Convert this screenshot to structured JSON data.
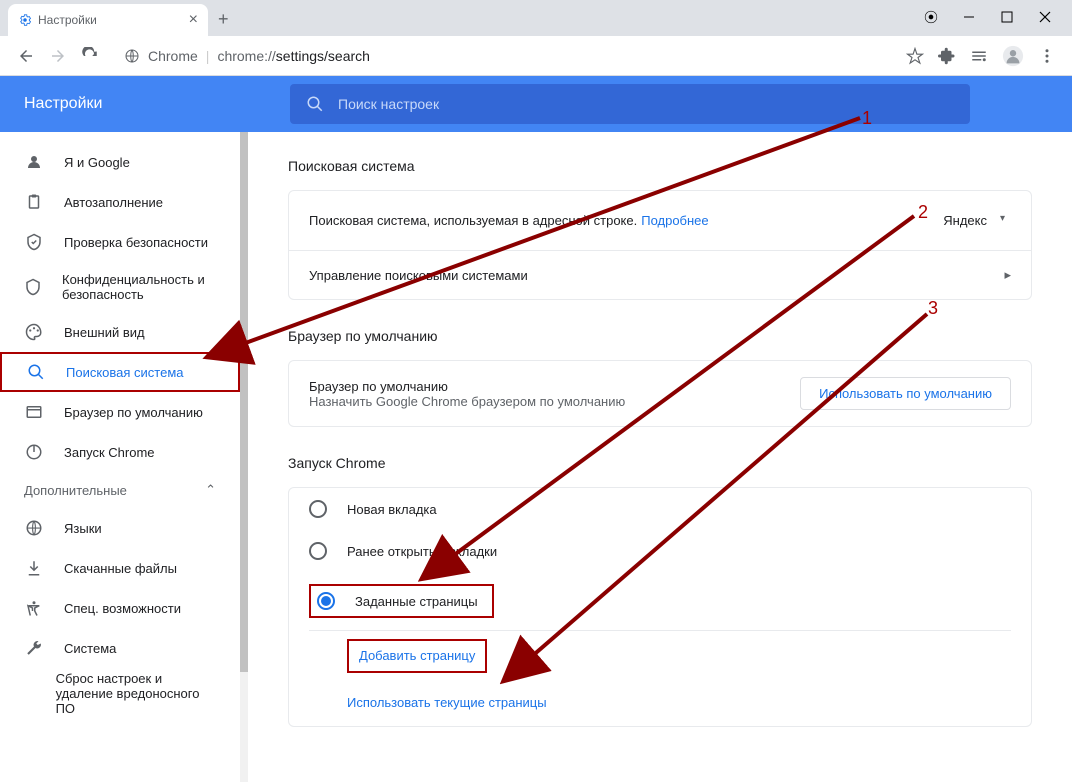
{
  "tab": {
    "title": "Настройки"
  },
  "url": {
    "host": "Chrome",
    "path": "chrome://settings/search",
    "path_protocol": "chrome://",
    "path_main": "settings/search"
  },
  "header": {
    "title": "Настройки"
  },
  "search": {
    "placeholder": "Поиск настроек"
  },
  "sidebar": {
    "items": [
      {
        "label": "Я и Google"
      },
      {
        "label": "Автозаполнение"
      },
      {
        "label": "Проверка безопасности"
      },
      {
        "label": "Конфиденциальность и безопасность"
      },
      {
        "label": "Внешний вид"
      },
      {
        "label": "Поисковая система"
      },
      {
        "label": "Браузер по умолчанию"
      },
      {
        "label": "Запуск Chrome"
      }
    ],
    "advanced_label": "Дополнительные",
    "advanced_items": [
      {
        "label": "Языки"
      },
      {
        "label": "Скачанные файлы"
      },
      {
        "label": "Спец. возможности"
      },
      {
        "label": "Система"
      },
      {
        "label": "Сброс настроек и удаление вредоносного ПО"
      }
    ]
  },
  "main": {
    "search_engine": {
      "title": "Поисковая система",
      "row1_text": "Поисковая система, используемая в адресной строке.",
      "row1_link": "Подробнее",
      "dropdown_value": "Яндекс",
      "row2_text": "Управление поисковыми системами"
    },
    "default_browser": {
      "title": "Браузер по умолчанию",
      "row_title": "Браузер по умолчанию",
      "row_subtitle": "Назначить Google Chrome браузером по умолчанию",
      "button": "Использовать по умолчанию"
    },
    "startup": {
      "title": "Запуск Chrome",
      "options": [
        {
          "label": "Новая вкладка"
        },
        {
          "label": "Ранее открытые вкладки"
        },
        {
          "label": "Заданные страницы"
        }
      ],
      "add_page": "Добавить страницу",
      "use_current": "Использовать текущие страницы"
    }
  },
  "annotations": {
    "n1": "1",
    "n2": "2",
    "n3": "3"
  }
}
